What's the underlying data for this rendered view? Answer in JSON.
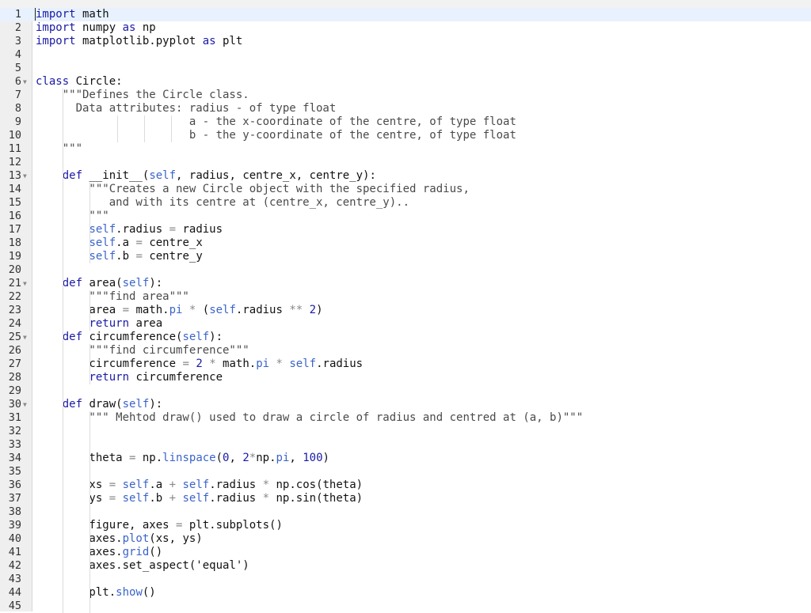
{
  "editor": {
    "active_line": 1,
    "lines": [
      [
        {
          "t": "import",
          "c": "kw"
        },
        {
          "t": " math"
        }
      ],
      [
        {
          "t": "import",
          "c": "kw"
        },
        {
          "t": " numpy "
        },
        {
          "t": "as",
          "c": "kw"
        },
        {
          "t": " np"
        }
      ],
      [
        {
          "t": "import",
          "c": "kw"
        },
        {
          "t": " matplotlib.pyplot "
        },
        {
          "t": "as",
          "c": "kw"
        },
        {
          "t": " plt"
        }
      ],
      [],
      [],
      [
        {
          "t": "class",
          "c": "kw"
        },
        {
          "t": " Circle:"
        }
      ],
      [
        {
          "t": "    \"\"\"Defines the Circle class.",
          "c": "str"
        }
      ],
      [
        {
          "t": "      Data attributes: radius - of type float",
          "c": "str"
        }
      ],
      [
        {
          "t": "                       a - the x-coordinate of the centre, of type float",
          "c": "str"
        }
      ],
      [
        {
          "t": "                       b - the y-coordinate of the centre, of type float",
          "c": "str"
        }
      ],
      [
        {
          "t": "    \"\"\"",
          "c": "str"
        }
      ],
      [],
      [
        {
          "t": "    "
        },
        {
          "t": "def",
          "c": "kw"
        },
        {
          "t": " __init__("
        },
        {
          "t": "self",
          "c": "slf"
        },
        {
          "t": ", radius, centre_x, centre_y):"
        }
      ],
      [
        {
          "t": "        \"\"\"Creates a new Circle object with the specified radius,",
          "c": "str"
        }
      ],
      [
        {
          "t": "           and with its centre at (centre_x, centre_y)..",
          "c": "str"
        }
      ],
      [
        {
          "t": "        \"\"\"",
          "c": "str"
        }
      ],
      [
        {
          "t": "        "
        },
        {
          "t": "self",
          "c": "slf"
        },
        {
          "t": ".radius "
        },
        {
          "t": "=",
          "c": "op"
        },
        {
          "t": " radius"
        }
      ],
      [
        {
          "t": "        "
        },
        {
          "t": "self",
          "c": "slf"
        },
        {
          "t": ".a "
        },
        {
          "t": "=",
          "c": "op"
        },
        {
          "t": " centre_x"
        }
      ],
      [
        {
          "t": "        "
        },
        {
          "t": "self",
          "c": "slf"
        },
        {
          "t": ".b "
        },
        {
          "t": "=",
          "c": "op"
        },
        {
          "t": " centre_y"
        }
      ],
      [],
      [
        {
          "t": "    "
        },
        {
          "t": "def",
          "c": "kw"
        },
        {
          "t": " area("
        },
        {
          "t": "self",
          "c": "slf"
        },
        {
          "t": "):"
        }
      ],
      [
        {
          "t": "        \"\"\"find area\"\"\"",
          "c": "str"
        }
      ],
      [
        {
          "t": "        area "
        },
        {
          "t": "=",
          "c": "op"
        },
        {
          "t": " math."
        },
        {
          "t": "pi",
          "c": "slf"
        },
        {
          "t": " "
        },
        {
          "t": "*",
          "c": "op"
        },
        {
          "t": " ("
        },
        {
          "t": "self",
          "c": "slf"
        },
        {
          "t": ".radius "
        },
        {
          "t": "**",
          "c": "op"
        },
        {
          "t": " "
        },
        {
          "t": "2",
          "c": "num"
        },
        {
          "t": ")"
        }
      ],
      [
        {
          "t": "        "
        },
        {
          "t": "return",
          "c": "kw"
        },
        {
          "t": " area"
        }
      ],
      [
        {
          "t": "    "
        },
        {
          "t": "def",
          "c": "kw"
        },
        {
          "t": " circumference("
        },
        {
          "t": "self",
          "c": "slf"
        },
        {
          "t": "):"
        }
      ],
      [
        {
          "t": "        \"\"\"find circumference\"\"\"",
          "c": "str"
        }
      ],
      [
        {
          "t": "        circumference "
        },
        {
          "t": "=",
          "c": "op"
        },
        {
          "t": " "
        },
        {
          "t": "2",
          "c": "num"
        },
        {
          "t": " "
        },
        {
          "t": "*",
          "c": "op"
        },
        {
          "t": " math."
        },
        {
          "t": "pi",
          "c": "slf"
        },
        {
          "t": " "
        },
        {
          "t": "*",
          "c": "op"
        },
        {
          "t": " "
        },
        {
          "t": "self",
          "c": "slf"
        },
        {
          "t": ".radius"
        }
      ],
      [
        {
          "t": "        "
        },
        {
          "t": "return",
          "c": "kw"
        },
        {
          "t": " circumference"
        }
      ],
      [],
      [
        {
          "t": "    "
        },
        {
          "t": "def",
          "c": "kw"
        },
        {
          "t": " draw("
        },
        {
          "t": "self",
          "c": "slf"
        },
        {
          "t": "):"
        }
      ],
      [
        {
          "t": "        \"\"\" Mehtod draw() used to draw a circle of radius and centred at (a, b)\"\"\"",
          "c": "str"
        }
      ],
      [],
      [],
      [
        {
          "t": "        theta "
        },
        {
          "t": "=",
          "c": "op"
        },
        {
          "t": " np."
        },
        {
          "t": "linspace",
          "c": "slf"
        },
        {
          "t": "("
        },
        {
          "t": "0",
          "c": "num"
        },
        {
          "t": ", "
        },
        {
          "t": "2",
          "c": "num"
        },
        {
          "t": "*",
          "c": "op"
        },
        {
          "t": "np."
        },
        {
          "t": "pi",
          "c": "slf"
        },
        {
          "t": ", "
        },
        {
          "t": "100",
          "c": "num"
        },
        {
          "t": ")"
        }
      ],
      [],
      [
        {
          "t": "        xs "
        },
        {
          "t": "=",
          "c": "op"
        },
        {
          "t": " "
        },
        {
          "t": "self",
          "c": "slf"
        },
        {
          "t": ".a "
        },
        {
          "t": "+",
          "c": "op"
        },
        {
          "t": " "
        },
        {
          "t": "self",
          "c": "slf"
        },
        {
          "t": ".radius "
        },
        {
          "t": "*",
          "c": "op"
        },
        {
          "t": " np.cos(theta)"
        }
      ],
      [
        {
          "t": "        ys "
        },
        {
          "t": "=",
          "c": "op"
        },
        {
          "t": " "
        },
        {
          "t": "self",
          "c": "slf"
        },
        {
          "t": ".b "
        },
        {
          "t": "+",
          "c": "op"
        },
        {
          "t": " "
        },
        {
          "t": "self",
          "c": "slf"
        },
        {
          "t": ".radius "
        },
        {
          "t": "*",
          "c": "op"
        },
        {
          "t": " np.sin(theta)"
        }
      ],
      [],
      [
        {
          "t": "        figure, axes "
        },
        {
          "t": "=",
          "c": "op"
        },
        {
          "t": " plt.subplots()"
        }
      ],
      [
        {
          "t": "        axes."
        },
        {
          "t": "plot",
          "c": "slf"
        },
        {
          "t": "(xs, ys)"
        }
      ],
      [
        {
          "t": "        axes."
        },
        {
          "t": "grid",
          "c": "slf"
        },
        {
          "t": "()"
        }
      ],
      [
        {
          "t": "        axes.set_aspect('equal')"
        }
      ],
      [],
      [
        {
          "t": "        plt."
        },
        {
          "t": "show",
          "c": "slf"
        },
        {
          "t": "()"
        }
      ],
      []
    ],
    "fold_lines": [
      6,
      13,
      21,
      25,
      30
    ]
  }
}
